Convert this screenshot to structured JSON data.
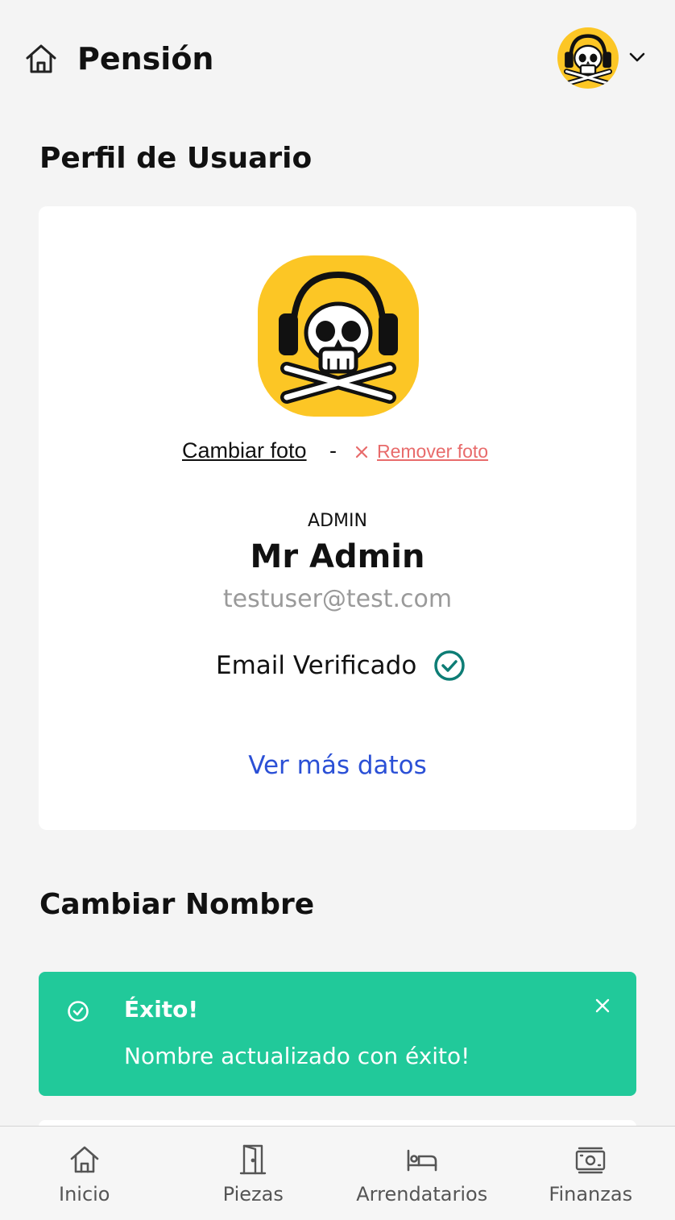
{
  "header": {
    "title": "Pensión",
    "home_icon": "home-icon",
    "avatar_icon": "skull-headphones-avatar",
    "menu_icon": "chevron-down-icon"
  },
  "profile": {
    "section_title": "Perfil de Usuario",
    "change_photo": "Cambiar foto",
    "separator": "-",
    "remove_photo": "Remover foto",
    "role": "ADMIN",
    "name": "Mr Admin",
    "email": "testuser@test.com",
    "verified_label": "Email Verificado",
    "more_link": "Ver más datos"
  },
  "change_name": {
    "section_title": "Cambiar Nombre"
  },
  "alert": {
    "title": "Éxito!",
    "message": "Nombre actualizado con éxito!"
  },
  "bottom_nav": [
    {
      "label": "Inicio",
      "icon": "home-icon"
    },
    {
      "label": "Piezas",
      "icon": "door-icon"
    },
    {
      "label": "Arrendatarios",
      "icon": "bed-icon"
    },
    {
      "label": "Finanzas",
      "icon": "money-icon"
    }
  ],
  "colors": {
    "background": "#f4f4f4",
    "avatar_yellow": "#fcc625",
    "success_green": "#21c99a",
    "link_blue": "#2b50d6",
    "remove_red": "#e86b6b",
    "verified_teal": "#0d7d75"
  }
}
